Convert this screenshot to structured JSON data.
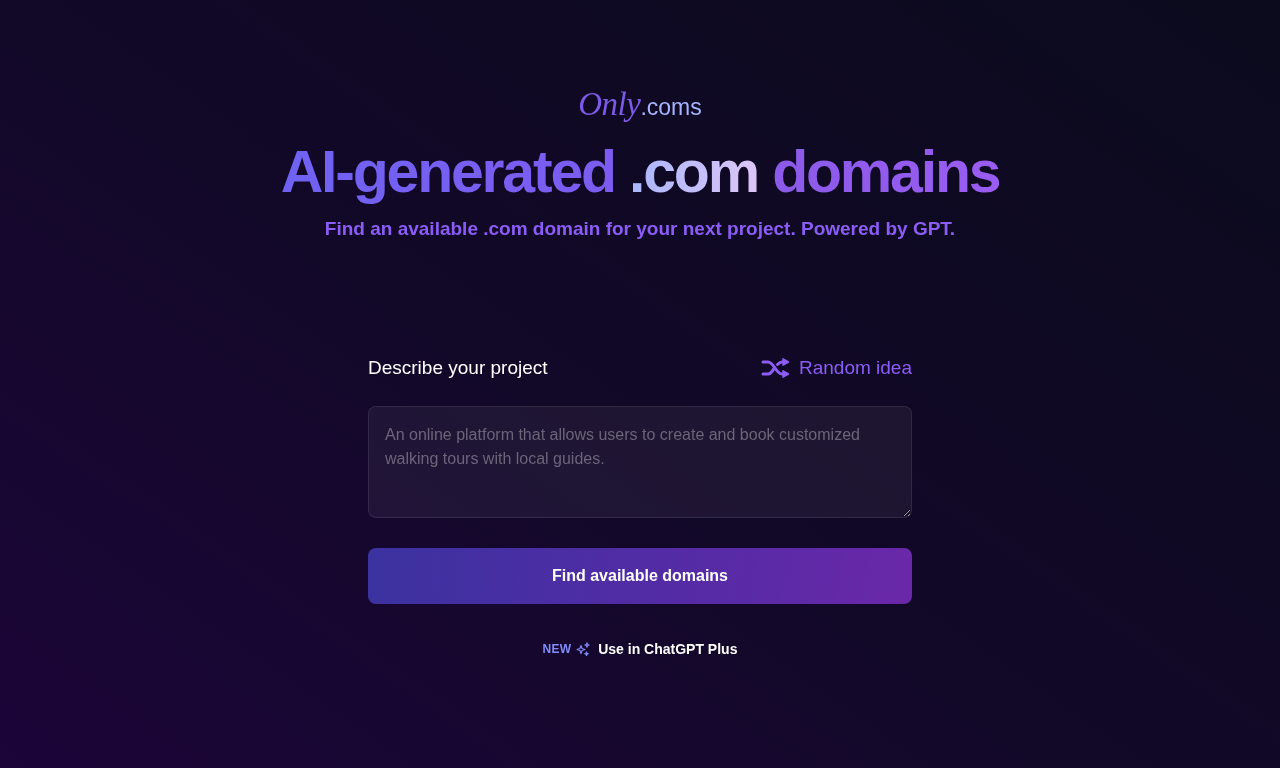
{
  "logo": {
    "script": "Only",
    "suffix": ".coms"
  },
  "headline": [
    {
      "text": "AI-generated ",
      "kind": "gradient"
    },
    {
      "text": ".com",
      "kind": "highlight"
    },
    {
      "text": " domains",
      "kind": "accent"
    }
  ],
  "subtitle": "Find an available .com domain for your next project. Powered by GPT.",
  "form": {
    "label": "Describe your project",
    "random_idea": "Random idea",
    "description": {
      "placeholder": "An online platform that allows users to create and book customized walking tours with local guides."
    },
    "submit": "Find available domains"
  },
  "promo": {
    "badge": "NEW",
    "link": "Use in ChatGPT Plus"
  }
}
